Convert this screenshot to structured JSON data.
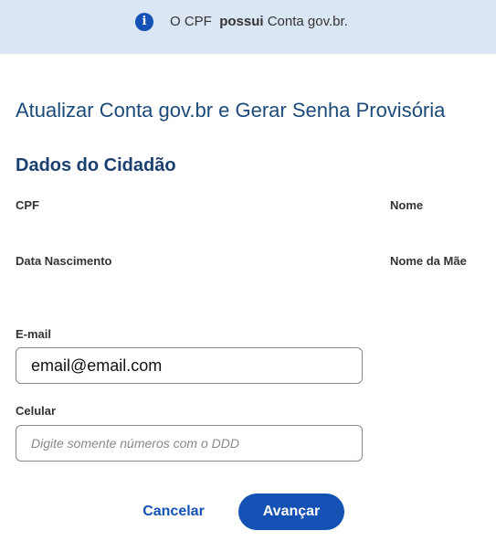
{
  "banner": {
    "icon": "info-icon",
    "icon_glyph": "i",
    "text_before": "O CPF",
    "text_bold": "possui",
    "text_after": "Conta gov.br.",
    "background_color": "#dbe6f5",
    "icon_color": "#1351b4"
  },
  "page": {
    "title": "Atualizar Conta gov.br e Gerar Senha Provisória",
    "section_title": "Dados do Cidadão"
  },
  "citizen": {
    "cpf_label": "CPF",
    "nome_label": "Nome",
    "data_nascimento_label": "Data Nascimento",
    "nome_mae_label": "Nome da Mãe"
  },
  "form": {
    "email": {
      "label": "E-mail",
      "value": "email@email.com"
    },
    "celular": {
      "label": "Celular",
      "value": "",
      "placeholder": "Digite somente números com o DDD"
    }
  },
  "actions": {
    "cancel_label": "Cancelar",
    "next_label": "Avançar",
    "primary_color": "#1351b4"
  }
}
